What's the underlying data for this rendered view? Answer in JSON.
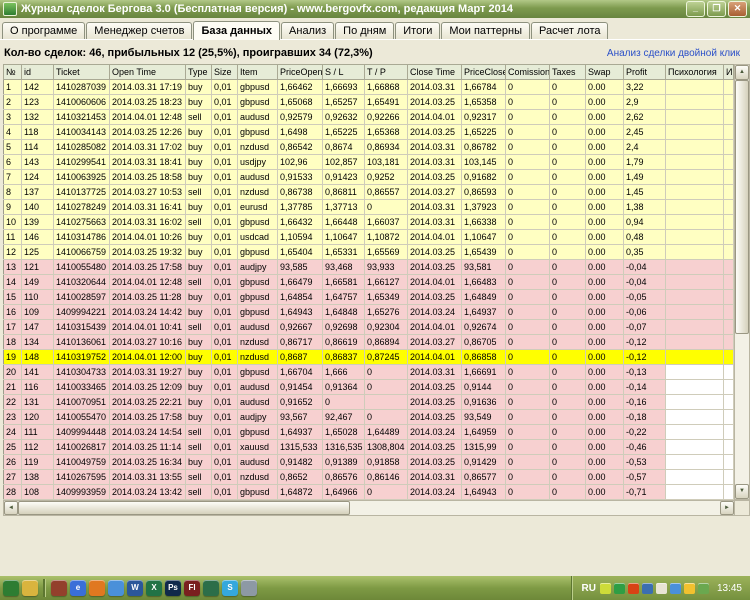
{
  "window": {
    "title": "Журнал сделок Бергова 3.0 (Бесплатная версия)  - www.bergovfx.com, редакция Март 2014",
    "controls": {
      "minimize": "_",
      "maximize": "❐",
      "close": "✕"
    }
  },
  "tabs": [
    {
      "label": "О программе",
      "active": false
    },
    {
      "label": "Менеджер счетов",
      "active": false
    },
    {
      "label": "База данных",
      "active": true
    },
    {
      "label": "Анализ",
      "active": false
    },
    {
      "label": "По дням",
      "active": false
    },
    {
      "label": "Итоги",
      "active": false
    },
    {
      "label": "Мои паттерны",
      "active": false
    },
    {
      "label": "Расчет лота",
      "active": false
    }
  ],
  "stats": {
    "summary": "Кол-во сделок: 46, прибыльных 12 (25,5%), проигравших 34 (72,3%)",
    "hint": "Анализ сделки двойной клик"
  },
  "scrollbar": {
    "up": "▲",
    "down": "▼",
    "left": "◄",
    "right": "►"
  },
  "colors": {
    "row_profit": "#ffffc2",
    "row_loss": "#f7d0d0",
    "row_selected": "#ffff00",
    "header_bg": "#e6ecd7",
    "link": "#2b50c8",
    "titlebar_green": "#7d9a4e",
    "taskbar_green": "#7e9a44"
  },
  "table": {
    "columns": [
      "№",
      "id",
      "Ticket",
      "Open Time",
      "Type",
      "Size",
      "Item",
      "PriceOpen",
      "S / L",
      "T / P",
      "Close Time",
      "PriceClose",
      "Comission",
      "Taxes",
      "Swap",
      "Profit",
      "Психология",
      "И"
    ],
    "rows": [
      {
        "no": 1,
        "id": "142",
        "ticket": "1410287039",
        "open_time": "2014.03.31 17:19",
        "type": "buy",
        "size": "0,01",
        "item": "gbpusd",
        "price_open": "1,66462",
        "sl": "1,66693",
        "tp": "1,66868",
        "close_time": "2014.03.31",
        "price_close": "1,66784",
        "comission": "0",
        "taxes": "0",
        "swap": "0.00",
        "profit": "3,22",
        "psychology": "",
        "state": "profit"
      },
      {
        "no": 2,
        "id": "123",
        "ticket": "1410060606",
        "open_time": "2014.03.25 18:23",
        "type": "buy",
        "size": "0,01",
        "item": "gbpusd",
        "price_open": "1,65068",
        "sl": "1,65257",
        "tp": "1,65491",
        "close_time": "2014.03.25",
        "price_close": "1,65358",
        "comission": "0",
        "taxes": "0",
        "swap": "0.00",
        "profit": "2,9",
        "psychology": "",
        "state": "profit"
      },
      {
        "no": 3,
        "id": "132",
        "ticket": "1410321453",
        "open_time": "2014.04.01 12:48",
        "type": "sell",
        "size": "0,01",
        "item": "audusd",
        "price_open": "0,92579",
        "sl": "0,92632",
        "tp": "0,92266",
        "close_time": "2014.04.01",
        "price_close": "0,92317",
        "comission": "0",
        "taxes": "0",
        "swap": "0.00",
        "profit": "2,62",
        "psychology": "",
        "state": "profit"
      },
      {
        "no": 4,
        "id": "118",
        "ticket": "1410034143",
        "open_time": "2014.03.25 12:26",
        "type": "buy",
        "size": "0,01",
        "item": "gbpusd",
        "price_open": "1,6498",
        "sl": "1,65225",
        "tp": "1,65368",
        "close_time": "2014.03.25",
        "price_close": "1,65225",
        "comission": "0",
        "taxes": "0",
        "swap": "0.00",
        "profit": "2,45",
        "psychology": "",
        "state": "profit"
      },
      {
        "no": 5,
        "id": "114",
        "ticket": "1410285082",
        "open_time": "2014.03.31 17:02",
        "type": "buy",
        "size": "0,01",
        "item": "nzdusd",
        "price_open": "0,86542",
        "sl": "0,8674",
        "tp": "0,86934",
        "close_time": "2014.03.31",
        "price_close": "0,86782",
        "comission": "0",
        "taxes": "0",
        "swap": "0.00",
        "profit": "2,4",
        "psychology": "",
        "state": "profit"
      },
      {
        "no": 6,
        "id": "143",
        "ticket": "1410299541",
        "open_time": "2014.03.31 18:41",
        "type": "buy",
        "size": "0,01",
        "item": "usdjpy",
        "price_open": "102,96",
        "sl": "102,857",
        "tp": "103,181",
        "close_time": "2014.03.31",
        "price_close": "103,145",
        "comission": "0",
        "taxes": "0",
        "swap": "0.00",
        "profit": "1,79",
        "psychology": "",
        "state": "profit"
      },
      {
        "no": 7,
        "id": "124",
        "ticket": "1410063925",
        "open_time": "2014.03.25 18:58",
        "type": "buy",
        "size": "0,01",
        "item": "audusd",
        "price_open": "0,91533",
        "sl": "0,91423",
        "tp": "0,9252",
        "close_time": "2014.03.25",
        "price_close": "0,91682",
        "comission": "0",
        "taxes": "0",
        "swap": "0.00",
        "profit": "1,49",
        "psychology": "",
        "state": "profit"
      },
      {
        "no": 8,
        "id": "137",
        "ticket": "1410137725",
        "open_time": "2014.03.27 10:53",
        "type": "sell",
        "size": "0,01",
        "item": "nzdusd",
        "price_open": "0,86738",
        "sl": "0,86811",
        "tp": "0,86557",
        "close_time": "2014.03.27",
        "price_close": "0,86593",
        "comission": "0",
        "taxes": "0",
        "swap": "0.00",
        "profit": "1,45",
        "psychology": "",
        "state": "profit"
      },
      {
        "no": 9,
        "id": "140",
        "ticket": "1410278249",
        "open_time": "2014.03.31 16:41",
        "type": "buy",
        "size": "0,01",
        "item": "eurusd",
        "price_open": "1,37785",
        "sl": "1,37713",
        "tp": "0",
        "close_time": "2014.03.31",
        "price_close": "1,37923",
        "comission": "0",
        "taxes": "0",
        "swap": "0.00",
        "profit": "1,38",
        "psychology": "",
        "state": "profit"
      },
      {
        "no": 10,
        "id": "139",
        "ticket": "1410275663",
        "open_time": "2014.03.31 16:02",
        "type": "sell",
        "size": "0,01",
        "item": "gbpusd",
        "price_open": "1,66432",
        "sl": "1,66448",
        "tp": "1,66037",
        "close_time": "2014.03.31",
        "price_close": "1,66338",
        "comission": "0",
        "taxes": "0",
        "swap": "0.00",
        "profit": "0,94",
        "psychology": "",
        "state": "profit"
      },
      {
        "no": 11,
        "id": "146",
        "ticket": "1410314786",
        "open_time": "2014.04.01 10:26",
        "type": "buy",
        "size": "0,01",
        "item": "usdcad",
        "price_open": "1,10594",
        "sl": "1,10647",
        "tp": "1,10872",
        "close_time": "2014.04.01",
        "price_close": "1,10647",
        "comission": "0",
        "taxes": "0",
        "swap": "0.00",
        "profit": "0,48",
        "psychology": "",
        "state": "profit"
      },
      {
        "no": 12,
        "id": "125",
        "ticket": "1410066759",
        "open_time": "2014.03.25 19:32",
        "type": "buy",
        "size": "0,01",
        "item": "gbpusd",
        "price_open": "1,65404",
        "sl": "1,65331",
        "tp": "1,65569",
        "close_time": "2014.03.25",
        "price_close": "1,65439",
        "comission": "0",
        "taxes": "0",
        "swap": "0.00",
        "profit": "0,35",
        "psychology": "",
        "state": "profit"
      },
      {
        "no": 13,
        "id": "121",
        "ticket": "1410055480",
        "open_time": "2014.03.25 17:58",
        "type": "buy",
        "size": "0,01",
        "item": "audjpy",
        "price_open": "93,585",
        "sl": "93,468",
        "tp": "93,933",
        "close_time": "2014.03.25",
        "price_close": "93,581",
        "comission": "0",
        "taxes": "0",
        "swap": "0.00",
        "profit": "-0,04",
        "psychology": "",
        "state": "loss"
      },
      {
        "no": 14,
        "id": "149",
        "ticket": "1410320644",
        "open_time": "2014.04.01 12:48",
        "type": "sell",
        "size": "0,01",
        "item": "gbpusd",
        "price_open": "1,66479",
        "sl": "1,66581",
        "tp": "1,66127",
        "close_time": "2014.04.01",
        "price_close": "1,66483",
        "comission": "0",
        "taxes": "0",
        "swap": "0.00",
        "profit": "-0,04",
        "psychology": "",
        "state": "loss"
      },
      {
        "no": 15,
        "id": "110",
        "ticket": "1410028597",
        "open_time": "2014.03.25 11:28",
        "type": "buy",
        "size": "0,01",
        "item": "gbpusd",
        "price_open": "1,64854",
        "sl": "1,64757",
        "tp": "1,65349",
        "close_time": "2014.03.25",
        "price_close": "1,64849",
        "comission": "0",
        "taxes": "0",
        "swap": "0.00",
        "profit": "-0,05",
        "psychology": "",
        "state": "loss"
      },
      {
        "no": 16,
        "id": "109",
        "ticket": "1409994221",
        "open_time": "2014.03.24 14:42",
        "type": "buy",
        "size": "0,01",
        "item": "gbpusd",
        "price_open": "1,64943",
        "sl": "1,64848",
        "tp": "1,65276",
        "close_time": "2014.03.24",
        "price_close": "1,64937",
        "comission": "0",
        "taxes": "0",
        "swap": "0.00",
        "profit": "-0,06",
        "psychology": "",
        "state": "loss"
      },
      {
        "no": 17,
        "id": "147",
        "ticket": "1410315439",
        "open_time": "2014.04.01 10:41",
        "type": "sell",
        "size": "0,01",
        "item": "audusd",
        "price_open": "0,92667",
        "sl": "0,92698",
        "tp": "0,92304",
        "close_time": "2014.04.01",
        "price_close": "0,92674",
        "comission": "0",
        "taxes": "0",
        "swap": "0.00",
        "profit": "-0,07",
        "psychology": "",
        "state": "loss"
      },
      {
        "no": 18,
        "id": "134",
        "ticket": "1410136061",
        "open_time": "2014.03.27 10:16",
        "type": "buy",
        "size": "0,01",
        "item": "nzdusd",
        "price_open": "0,86717",
        "sl": "0,86619",
        "tp": "0,86894",
        "close_time": "2014.03.27",
        "price_close": "0,86705",
        "comission": "0",
        "taxes": "0",
        "swap": "0.00",
        "profit": "-0,12",
        "psychology": "",
        "state": "loss"
      },
      {
        "no": 19,
        "id": "148",
        "ticket": "1410319752",
        "open_time": "2014.04.01 12:00",
        "type": "buy",
        "size": "0,01",
        "item": "nzdusd",
        "price_open": "0,8687",
        "sl": "0,86837",
        "tp": "0,87245",
        "close_time": "2014.04.01",
        "price_close": "0,86858",
        "comission": "0",
        "taxes": "0",
        "swap": "0.00",
        "profit": "-0,12",
        "psychology": "",
        "state": "selected"
      },
      {
        "no": 20,
        "id": "141",
        "ticket": "1410304733",
        "open_time": "2014.03.31 19:27",
        "type": "buy",
        "size": "0,01",
        "item": "gbpusd",
        "price_open": "1,66704",
        "sl": "1,666",
        "tp": "0",
        "close_time": "2014.03.31",
        "price_close": "1,66691",
        "comission": "0",
        "taxes": "0",
        "swap": "0.00",
        "profit": "-0,13",
        "psychology": "",
        "state": "loss",
        "tail_blank": true
      },
      {
        "no": 21,
        "id": "116",
        "ticket": "1410033465",
        "open_time": "2014.03.25 12:09",
        "type": "buy",
        "size": "0,01",
        "item": "audusd",
        "price_open": "0,91454",
        "sl": "0,91364",
        "tp": "0",
        "close_time": "2014.03.25",
        "price_close": "0,9144",
        "comission": "0",
        "taxes": "0",
        "swap": "0.00",
        "profit": "-0,14",
        "psychology": "",
        "state": "loss",
        "tail_blank": true
      },
      {
        "no": 22,
        "id": "131",
        "ticket": "1410070951",
        "open_time": "2014.03.25 22:21",
        "type": "buy",
        "size": "0,01",
        "item": "audusd",
        "price_open": "0,91652",
        "sl": "0",
        "tp": "",
        "close_time": "2014.03.25",
        "price_close": "0,91636",
        "comission": "0",
        "taxes": "0",
        "swap": "0.00",
        "profit": "-0,16",
        "psychology": "",
        "state": "loss",
        "tail_blank": true
      },
      {
        "no": 23,
        "id": "120",
        "ticket": "1410055470",
        "open_time": "2014.03.25 17:58",
        "type": "buy",
        "size": "0,01",
        "item": "audjpy",
        "price_open": "93,567",
        "sl": "92,467",
        "tp": "0",
        "close_time": "2014.03.25",
        "price_close": "93,549",
        "comission": "0",
        "taxes": "0",
        "swap": "0.00",
        "profit": "-0,18",
        "psychology": "",
        "state": "loss",
        "tail_blank": true
      },
      {
        "no": 24,
        "id": "111",
        "ticket": "1409994448",
        "open_time": "2014.03.24 14:54",
        "type": "sell",
        "size": "0,01",
        "item": "gbpusd",
        "price_open": "1,64937",
        "sl": "1,65028",
        "tp": "1,64489",
        "close_time": "2014.03.24",
        "price_close": "1,64959",
        "comission": "0",
        "taxes": "0",
        "swap": "0.00",
        "profit": "-0,22",
        "psychology": "",
        "state": "loss",
        "tail_blank": true
      },
      {
        "no": 25,
        "id": "112",
        "ticket": "1410026817",
        "open_time": "2014.03.25 11:14",
        "type": "sell",
        "size": "0,01",
        "item": "xauusd",
        "price_open": "1315,533",
        "sl": "1316,535",
        "tp": "1308,804",
        "close_time": "2014.03.25",
        "price_close": "1315,99",
        "comission": "0",
        "taxes": "0",
        "swap": "0.00",
        "profit": "-0,46",
        "psychology": "",
        "state": "loss",
        "tail_blank": true
      },
      {
        "no": 26,
        "id": "119",
        "ticket": "1410049759",
        "open_time": "2014.03.25 16:34",
        "type": "buy",
        "size": "0,01",
        "item": "audusd",
        "price_open": "0,91482",
        "sl": "0,91389",
        "tp": "0,91858",
        "close_time": "2014.03.25",
        "price_close": "0,91429",
        "comission": "0",
        "taxes": "0",
        "swap": "0.00",
        "profit": "-0,53",
        "psychology": "",
        "state": "loss",
        "tail_blank": true
      },
      {
        "no": 27,
        "id": "138",
        "ticket": "1410267595",
        "open_time": "2014.03.31 13:55",
        "type": "sell",
        "size": "0,01",
        "item": "nzdusd",
        "price_open": "0,8652",
        "sl": "0,86576",
        "tp": "0,86146",
        "close_time": "2014.03.31",
        "price_close": "0,86577",
        "comission": "0",
        "taxes": "0",
        "swap": "0.00",
        "profit": "-0,57",
        "psychology": "",
        "state": "loss",
        "tail_blank": true
      },
      {
        "no": 28,
        "id": "108",
        "ticket": "1409993959",
        "open_time": "2014.03.24 13:42",
        "type": "sell",
        "size": "0,01",
        "item": "gbpusd",
        "price_open": "1,64872",
        "sl": "1,64966",
        "tp": "0",
        "close_time": "2014.03.24",
        "price_close": "1,64943",
        "comission": "0",
        "taxes": "0",
        "swap": "0.00",
        "profit": "-0,71",
        "psychology": "",
        "state": "loss",
        "tail_blank": true
      }
    ]
  },
  "taskbar": {
    "language": "RU",
    "clock": "13:45",
    "icons": [
      {
        "name": "start-menu-icon",
        "color": "#2e7d32"
      },
      {
        "name": "desktop-folder-icon",
        "color": "#d9b43e"
      },
      {
        "type": "separator",
        "name": "taskbar-separator"
      },
      {
        "name": "media-player-icon",
        "color": "#93402c"
      },
      {
        "name": "internet-explorer-icon",
        "color": "#3a6fd8",
        "glyph": "e"
      },
      {
        "name": "firefox-icon",
        "color": "#e07820"
      },
      {
        "name": "mail-icon",
        "color": "#4a90d9"
      },
      {
        "name": "word-icon",
        "color": "#2b579a",
        "glyph": "W"
      },
      {
        "name": "excel-icon",
        "color": "#217346",
        "glyph": "X"
      },
      {
        "name": "photoshop-icon",
        "color": "#10294a",
        "glyph": "Ps"
      },
      {
        "name": "flash-icon",
        "color": "#7a1f1f",
        "glyph": "Fl"
      },
      {
        "name": "metatrader-icon",
        "color": "#2c6e49"
      },
      {
        "name": "skype-icon",
        "color": "#35a8dc",
        "glyph": "S"
      },
      {
        "name": "notepad-icon",
        "color": "#8d99a4"
      }
    ],
    "tray_icons": [
      {
        "name": "pencil-tray-icon",
        "color": "#cddc39"
      },
      {
        "name": "antivirus-icon",
        "color": "#2e9e44"
      },
      {
        "name": "update-icon",
        "color": "#d84315"
      },
      {
        "name": "messenger-icon",
        "color": "#3b6fb0"
      },
      {
        "name": "volume-icon",
        "color": "#e8e4d4"
      },
      {
        "name": "network-icon",
        "color": "#4a90d9"
      },
      {
        "name": "battery-icon",
        "color": "#f2c12e"
      },
      {
        "name": "shield-icon",
        "color": "#6aa84f"
      }
    ]
  }
}
